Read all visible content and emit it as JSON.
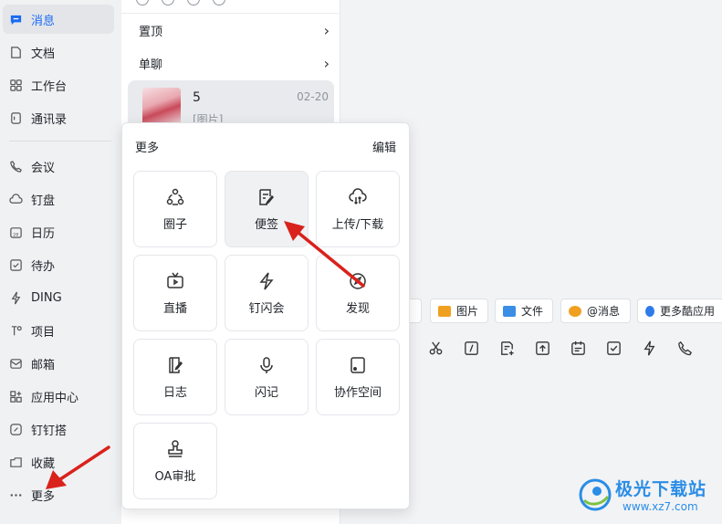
{
  "nav": {
    "items": [
      {
        "label": "消息",
        "icon": "message-icon",
        "active": true
      },
      {
        "label": "文档",
        "icon": "document-icon"
      },
      {
        "label": "工作台",
        "icon": "grid-icon"
      },
      {
        "label": "通讯录",
        "icon": "contacts-icon"
      },
      {
        "label": "会议",
        "icon": "phone-icon"
      },
      {
        "label": "钉盘",
        "icon": "cloud-icon"
      },
      {
        "label": "日历",
        "icon": "calendar-icon"
      },
      {
        "label": "待办",
        "icon": "checkbox-icon"
      },
      {
        "label": "DING",
        "icon": "lightning-icon"
      },
      {
        "label": "项目",
        "icon": "project-icon"
      },
      {
        "label": "邮箱",
        "icon": "mail-icon"
      },
      {
        "label": "应用中心",
        "icon": "apps-icon"
      },
      {
        "label": "钉钉搭",
        "icon": "builder-icon"
      },
      {
        "label": "收藏",
        "icon": "folder-icon"
      },
      {
        "label": "更多",
        "icon": "more-icon"
      }
    ]
  },
  "conv": {
    "rows": [
      {
        "label": "置顶",
        "chevron": "›"
      },
      {
        "label": "单聊",
        "chevron": "›"
      }
    ],
    "chat": {
      "name": "5",
      "time": "02-20",
      "preview": "[图片]"
    }
  },
  "more_panel": {
    "title": "更多",
    "edit_label": "编辑",
    "tiles": [
      {
        "label": "圈子",
        "icon": "circle-group-icon"
      },
      {
        "label": "便签",
        "icon": "note-icon"
      },
      {
        "label": "上传/下载",
        "icon": "cloud-transfer-icon"
      },
      {
        "label": "直播",
        "icon": "tv-icon"
      },
      {
        "label": "钉闪会",
        "icon": "flash-meeting-icon"
      },
      {
        "label": "发现",
        "icon": "compass-icon"
      },
      {
        "label": "日志",
        "icon": "log-icon"
      },
      {
        "label": "闪记",
        "icon": "mic-icon"
      },
      {
        "label": "协作空间",
        "icon": "workspace-icon"
      },
      {
        "label": "OA审批",
        "icon": "stamp-icon"
      }
    ]
  },
  "toolbar": {
    "buttons": [
      {
        "label": "",
        "icon": "partial-icon"
      },
      {
        "label": "图片",
        "icon": "image-icon",
        "color": "#f0a020"
      },
      {
        "label": "文件",
        "icon": "file-icon",
        "color": "#3a8ee6"
      },
      {
        "label": "@消息",
        "icon": "at-icon",
        "color": "#f0a020"
      },
      {
        "label": "更多酷应用",
        "icon": "cool-app-icon",
        "color": "#2d7be8"
      }
    ],
    "icons": [
      "scissors-icon",
      "slash-icon",
      "note-add-icon",
      "upload-icon",
      "calendar-icon",
      "check-icon",
      "lightning-icon",
      "phone-icon"
    ]
  },
  "watermark": {
    "title": "极光下载站",
    "url": "www.xz7.com"
  },
  "colors": {
    "accent": "#1a6bf4",
    "arrow": "#d9221c",
    "watermark": "#2a8de6"
  }
}
